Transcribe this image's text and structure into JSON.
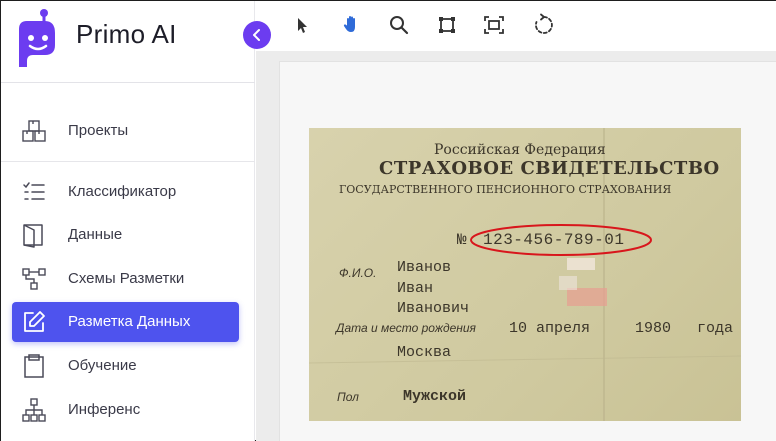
{
  "brand": {
    "name": "Primo AI"
  },
  "sidebar": {
    "items": [
      {
        "label": "Проекты",
        "icon": "boxes-icon"
      },
      {
        "label": "Классификатор",
        "icon": "checklist-icon"
      },
      {
        "label": "Данные",
        "icon": "book-icon"
      },
      {
        "label": "Схемы Разметки",
        "icon": "schema-icon"
      },
      {
        "label": "Разметка Данных",
        "icon": "edit-icon",
        "active": true
      },
      {
        "label": "Обучение",
        "icon": "clipboard-icon"
      },
      {
        "label": "Инференс",
        "icon": "hierarchy-icon"
      }
    ]
  },
  "toolbar": {
    "tools": [
      "select-icon",
      "hand-icon",
      "zoom-icon",
      "crop-icon",
      "fit-screen-icon",
      "rotate-icon"
    ]
  },
  "document": {
    "country": "Российская Федерация",
    "title": "СТРАХОВОЕ СВИДЕТЕЛЬСТВО",
    "subtitle": "ГОСУДАРСТВЕННОГО ПЕНСИОННОГО СТРАХОВАНИЯ",
    "number_prefix": "№",
    "number": "123-456-789-01",
    "fio_label": "Ф.И.О.",
    "surname": "Иванов",
    "name": "Иван",
    "patronymic": "Иванович",
    "birth_label": "Дата и место рождения",
    "birth_day_month": "10 апреля",
    "birth_year": "1980",
    "birth_year_suffix": "года",
    "birth_place": "Москва",
    "sex_label": "Пол",
    "sex": "Мужской"
  },
  "colors": {
    "accent": "#4e53ee",
    "brand": "#6c3cf0",
    "highlight": "#d8161c"
  }
}
